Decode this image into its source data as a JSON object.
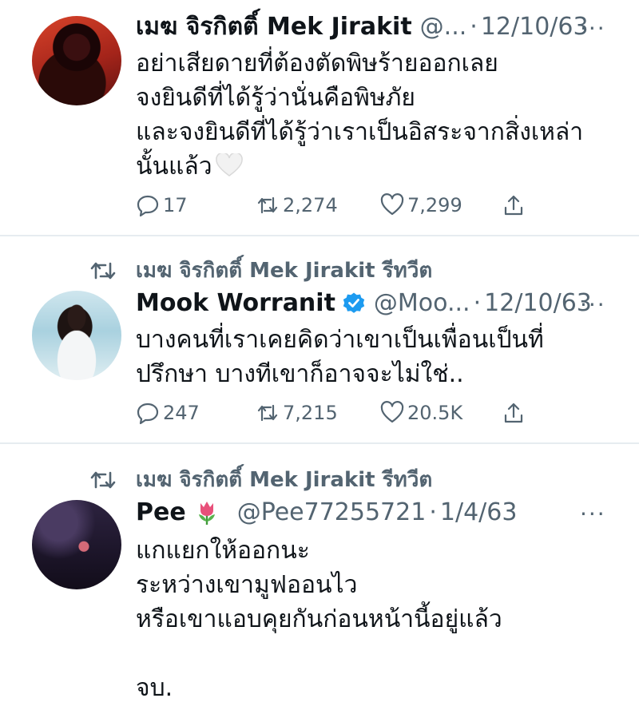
{
  "tweets": [
    {
      "name": "เมฆ จิรกิตติ์ Mek Jirakit",
      "handle": "@...",
      "date": "12/10/63",
      "text": "อย่าเสียดายที่ต้องตัดพิษร้ายออกเลย\nจงยินดีที่ได้รู้ว่านั่นคือพิษภัย\nและจงยินดีที่ได้รู้ว่าเราเป็นอิสระจากสิ่งเหล่า\nนั้นแล้ว",
      "replies": "17",
      "retweets": "2,274",
      "likes": "7,299"
    },
    {
      "retweeted_by": "เมฆ จิรกิตติ์ Mek Jirakit รีทวีต",
      "name": "Mook Worranit",
      "handle": "@Moo...",
      "date": "12/10/63",
      "text": "บางคนที่เราเคยคิดว่าเขาเป็นเพื่อนเป็นที่\nปรึกษา บางทีเขาก็อาจจะไม่ใช่..",
      "replies": "247",
      "retweets": "7,215",
      "likes": "20.5K"
    },
    {
      "retweeted_by": "เมฆ จิรกิตติ์ Mek Jirakit รีทวีต",
      "name": "Pee",
      "handle": "@Pee77255721",
      "date": "1/4/63",
      "text": "แกแยกให้ออกนะ\nระหว่างเขามูฟออนไว\nหรือเขาแอบคุยกันก่อนหน้านี้อยู่แล้ว\n\nจบ."
    }
  ],
  "more_symbol": "···",
  "separator": "·",
  "colors": {
    "secondary": "#536471",
    "verified": "#1d9bf0",
    "divider": "#e6ecf0"
  }
}
